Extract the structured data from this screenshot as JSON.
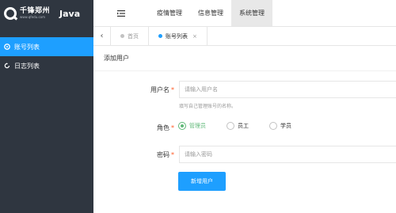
{
  "brand": {
    "name_cn": "千锋郑州",
    "url": "www.qfedu.com",
    "suffix": "Java"
  },
  "sidebar": {
    "items": [
      {
        "label": "账号列表",
        "icon": "gear-icon",
        "active": true
      },
      {
        "label": "日志列表",
        "icon": "refresh-icon",
        "active": false
      }
    ]
  },
  "topnav": {
    "toggle_icon": "menu-toggle-icon",
    "items": [
      {
        "label": "疫情管理",
        "active": false
      },
      {
        "label": "信息管理",
        "active": false
      },
      {
        "label": "系统管理",
        "active": true
      }
    ]
  },
  "tabs": {
    "back_glyph": "‹",
    "items": [
      {
        "label": "首页",
        "active": false
      },
      {
        "label": "账号列表",
        "active": true,
        "close": "×"
      }
    ]
  },
  "page": {
    "title": "添加用户"
  },
  "form": {
    "username": {
      "label": "用户名",
      "required_mark": "*",
      "placeholder": "请输入用户名",
      "hint": "填写自己管理账号的名称。"
    },
    "role": {
      "label": "角色",
      "required_mark": "*",
      "options": [
        {
          "label": "管理员",
          "checked": true
        },
        {
          "label": "员工",
          "checked": false
        },
        {
          "label": "学员",
          "checked": false
        }
      ]
    },
    "password": {
      "label": "密码",
      "required_mark": "*",
      "placeholder": "请输入密码"
    },
    "submit_label": "新增用户"
  },
  "colors": {
    "sidebar_bg": "#2f3640",
    "accent": "#1e9fff",
    "radio_checked": "#5fb878",
    "required": "#ff5722"
  }
}
